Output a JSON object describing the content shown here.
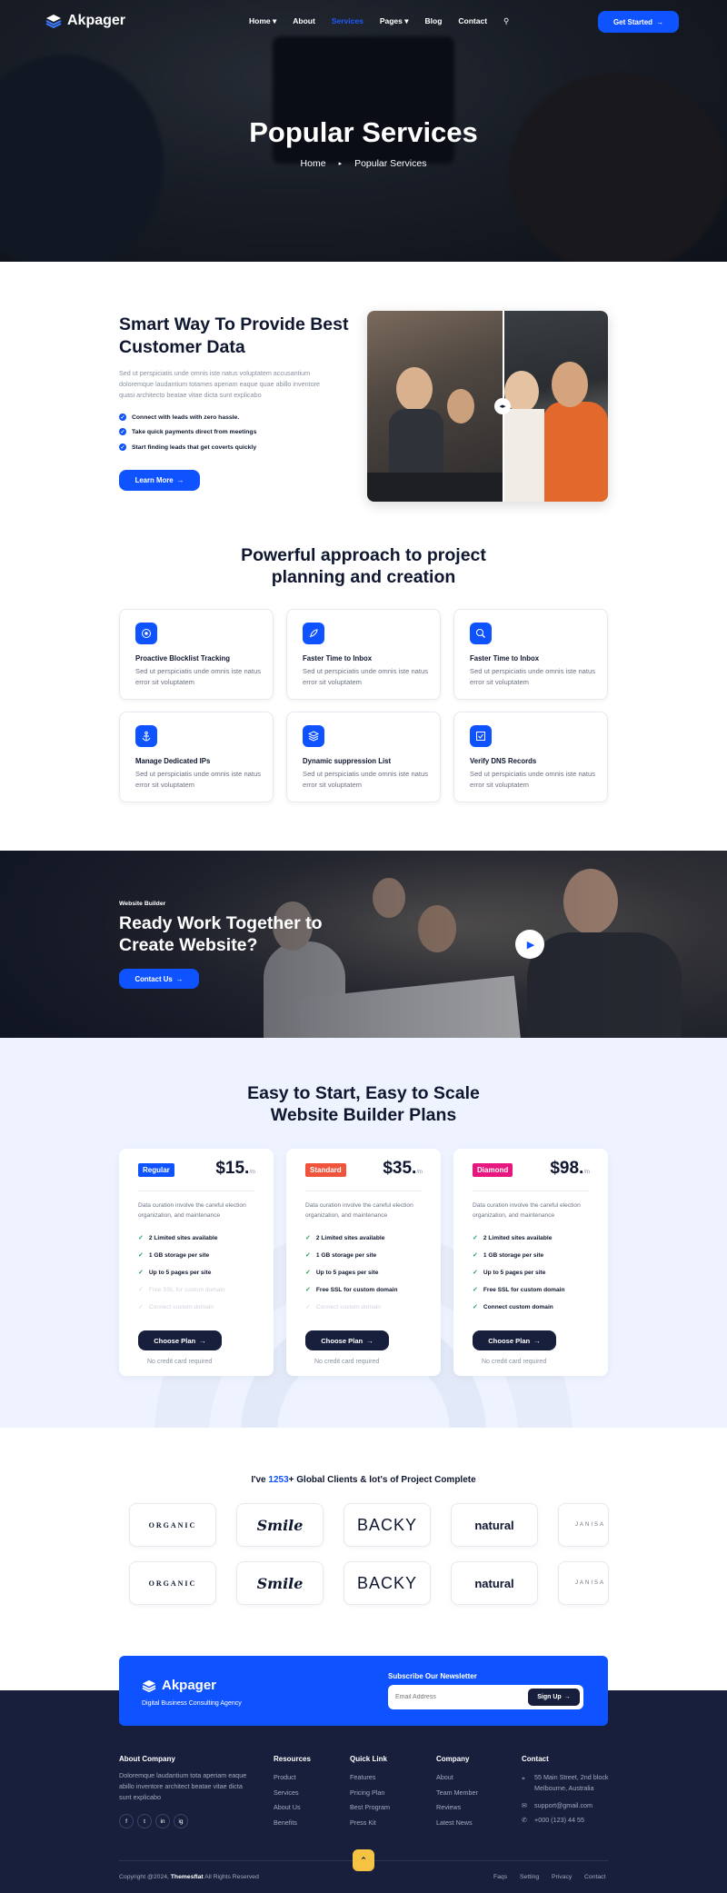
{
  "brand": {
    "name": "Akpager",
    "tagline": "Digital Business Consulting Agency"
  },
  "nav": {
    "items": [
      {
        "label": "Home",
        "has_dropdown": true
      },
      {
        "label": "About",
        "has_dropdown": false
      },
      {
        "label": "Services",
        "has_dropdown": false,
        "active": true
      },
      {
        "label": "Pages",
        "has_dropdown": true
      },
      {
        "label": "Blog",
        "has_dropdown": false
      },
      {
        "label": "Contact",
        "has_dropdown": false
      }
    ],
    "cta": "Get Started"
  },
  "hero": {
    "title": "Popular Services",
    "breadcrumb": [
      "Home",
      "Popular Services"
    ]
  },
  "smart": {
    "title": "Smart Way To Provide Best Customer Data",
    "description": "Sed ut perspiciatis unde omnis iste natus voluptatem accusantium doloremque laudantium totames aperiam eaque quae abillo inventore quasi architecto beatae vitae dicta sunt explicabo",
    "checks": [
      "Connect with leads with zero hassle.",
      "Take quick payments direct from meetings",
      "Start finding leads that get coverts quickly"
    ],
    "button": "Learn More"
  },
  "approach": {
    "title_line1": "Powerful approach to project",
    "title_line2": "planning and creation",
    "cards": [
      {
        "title": "Proactive Blocklist Tracking",
        "desc": "Sed ut perspiciatis unde omnis iste natus error sit voluptatem",
        "icon": "target-icon"
      },
      {
        "title": "Faster Time to Inbox",
        "desc": "Sed ut perspiciatis unde omnis iste natus error sit voluptatem",
        "icon": "rocket-icon"
      },
      {
        "title": "Faster Time to Inbox",
        "desc": "Sed ut perspiciatis unde omnis iste natus error sit voluptatem",
        "icon": "search-icon"
      },
      {
        "title": "Manage Dedicated IPs",
        "desc": "Sed ut perspiciatis unde omnis iste natus error sit voluptatem",
        "icon": "anchor-icon"
      },
      {
        "title": "Dynamic suppression List",
        "desc": "Sed ut perspiciatis unde omnis iste natus error sit voluptatem",
        "icon": "layers-icon"
      },
      {
        "title": "Verify DNS Records",
        "desc": "Sed ut perspiciatis unde omnis iste natus error sit voluptatem",
        "icon": "checkbox-icon"
      }
    ]
  },
  "banner": {
    "eyebrow": "Website Builder",
    "title_line1": "Ready Work Together to",
    "title_line2": "Create Website?",
    "button": "Contact Us"
  },
  "pricing": {
    "title_line1": "Easy to Start, Easy to Scale",
    "title_line2": "Website Builder Plans",
    "plans": [
      {
        "name": "Regular",
        "color": "#0f52ff",
        "price": "$15.",
        "unit": "/m",
        "desc": "Data curation involve the careful election organization, and maintenance",
        "features": [
          {
            "text": "2 Limited sites available",
            "on": true
          },
          {
            "text": "1 GB storage per site",
            "on": true
          },
          {
            "text": "Up to 5 pages per site",
            "on": true
          },
          {
            "text": "Free SSL for custom domain",
            "on": false
          },
          {
            "text": "Connect custom domain",
            "on": false
          }
        ],
        "button": "Choose Plan",
        "note": "No credit card required"
      },
      {
        "name": "Standard",
        "color": "#f0543c",
        "price": "$35.",
        "unit": "/m",
        "desc": "Data curation involve the careful election organization, and maintenance",
        "features": [
          {
            "text": "2 Limited sites available",
            "on": true
          },
          {
            "text": "1 GB storage per site",
            "on": true
          },
          {
            "text": "Up to 5 pages per site",
            "on": true
          },
          {
            "text": "Free SSL for custom domain",
            "on": true
          },
          {
            "text": "Connect custom domain",
            "on": false
          }
        ],
        "button": "Choose Plan",
        "note": "No credit card required"
      },
      {
        "name": "Diamond",
        "color": "#e8177f",
        "price": "$98.",
        "unit": "/m",
        "desc": "Data curation involve the careful election organization, and maintenance",
        "features": [
          {
            "text": "2 Limited sites available",
            "on": true
          },
          {
            "text": "1 GB storage per site",
            "on": true
          },
          {
            "text": "Up to 5 pages per site",
            "on": true
          },
          {
            "text": "Free SSL for custom domain",
            "on": true
          },
          {
            "text": "Connect custom domain",
            "on": true
          }
        ],
        "button": "Choose Plan",
        "note": "No credit card required"
      }
    ]
  },
  "clients": {
    "prefix": "I've ",
    "count": "1253",
    "suffix": "+ Global Clients & lot's of Project Complete",
    "logos": [
      "ORGANIC",
      "Smile",
      "BACKY",
      "natural",
      "JANISA"
    ]
  },
  "newsletter": {
    "title": "Subscribe Our Newsletter",
    "placeholder": "Email Address",
    "button": "Sign Up"
  },
  "footer": {
    "about": {
      "title": "About Company",
      "text": "Doloremque laudantium tota aperiam eaque abillo inventore architect beatae vitae dicta sunt explicabo"
    },
    "resources": {
      "title": "Resources",
      "links": [
        "Product",
        "Services",
        "About Us",
        "Benefits"
      ]
    },
    "quick": {
      "title": "Quick Link",
      "links": [
        "Features",
        "Pricing Plan",
        "Best Program",
        "Press Kit"
      ]
    },
    "company": {
      "title": "Company",
      "links": [
        "About",
        "Team Member",
        "Reviews",
        "Latest News"
      ]
    },
    "contact": {
      "title": "Contact",
      "address": "55 Main Street, 2nd block Melbourne, Australia",
      "email": "support@gmail.com",
      "phone": "+000 (123) 44 55"
    },
    "socials": [
      "f",
      "t",
      "in",
      "ig"
    ],
    "copyright_pre": "Copyright @2024, ",
    "copyright_brand": "Themesflat",
    "copyright_post": " All Rights Reserved",
    "bottom_links": [
      "Faqs",
      "Setting",
      "Privacy",
      "Contact"
    ]
  }
}
